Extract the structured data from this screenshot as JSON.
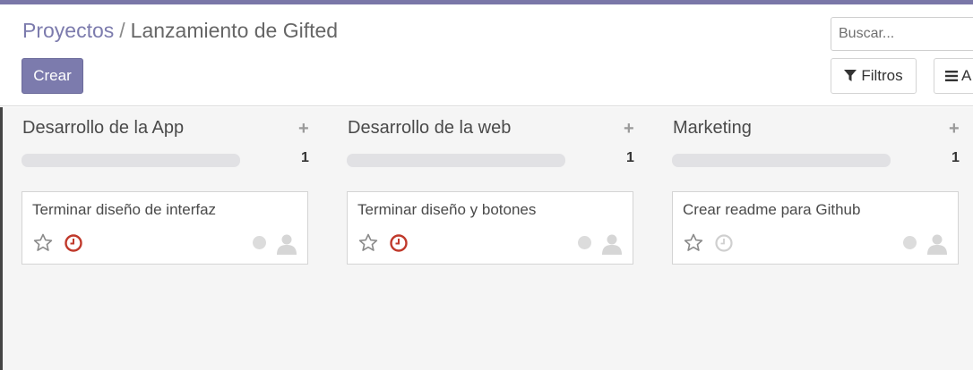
{
  "breadcrumb": {
    "parent": "Proyectos",
    "separator": "/",
    "current": "Lanzamiento de Gifted"
  },
  "actions": {
    "create_label": "Crear"
  },
  "search": {
    "placeholder": "Buscar..."
  },
  "filters": {
    "filter_label": "Filtros",
    "group_label": "A"
  },
  "colors": {
    "accent": "#7c7bad",
    "deadline_overdue": "#c0392b",
    "deadline_none": "#cfcfcf"
  },
  "columns": [
    {
      "title": "Desarrollo de la App",
      "add_icon": "plus-icon",
      "count": "1",
      "cards": [
        {
          "title": "Terminar diseño de interfaz",
          "deadline": "overdue",
          "starred": false
        }
      ]
    },
    {
      "title": "Desarrollo de la web",
      "add_icon": "plus-icon",
      "count": "1",
      "cards": [
        {
          "title": "Terminar diseño y botones",
          "deadline": "overdue",
          "starred": false
        }
      ]
    },
    {
      "title": "Marketing",
      "add_icon": "plus-icon",
      "count": "1",
      "cards": [
        {
          "title": "Crear readme para Github",
          "deadline": "none",
          "starred": false
        }
      ]
    }
  ]
}
